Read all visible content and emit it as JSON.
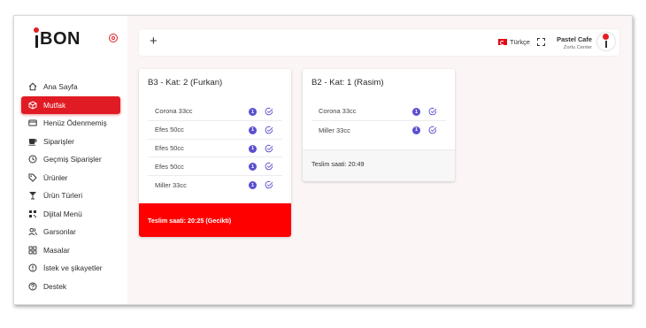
{
  "brand": {
    "logo_text": "BON",
    "logo_full": "İBON",
    "accent": "#e31e24"
  },
  "sidebar": {
    "items": [
      {
        "label": "Ana Sayfa",
        "icon": "home-icon"
      },
      {
        "label": "Mutfak",
        "icon": "kitchen-icon",
        "active": true
      },
      {
        "label": "Henüz Ödenmemiş",
        "icon": "card-icon"
      },
      {
        "label": "Siparişler",
        "icon": "cup-icon"
      },
      {
        "label": "Geçmiş Siparişler",
        "icon": "history-icon"
      },
      {
        "label": "Ürünler",
        "icon": "tag-icon"
      },
      {
        "label": "Ürün Türleri",
        "icon": "cocktail-icon"
      },
      {
        "label": "Dijital Menü",
        "icon": "qr-icon"
      },
      {
        "label": "Garsonlar",
        "icon": "users-icon"
      },
      {
        "label": "Masalar",
        "icon": "grid-icon"
      },
      {
        "label": "İstek ve şikayetler",
        "icon": "alert-icon"
      },
      {
        "label": "Destek",
        "icon": "help-icon"
      }
    ]
  },
  "header": {
    "add_label": "+",
    "language": "Türkçe",
    "cafe_name": "Pastel Cafe",
    "branch": "Zorlu Center"
  },
  "orders": [
    {
      "title": "B3 - Kat: 2 (Furkan)",
      "items": [
        {
          "name": "Corona 33cc",
          "qty": "1"
        },
        {
          "name": "Efes 50cc",
          "qty": "1"
        },
        {
          "name": "Efes 50cc",
          "qty": "1"
        },
        {
          "name": "Efes 50cc",
          "qty": "1"
        },
        {
          "name": "Miller 33cc",
          "qty": "1"
        }
      ],
      "footer": "Teslim saati: 20:25 (Gecikti)",
      "late": true
    },
    {
      "title": "B2 - Kat: 1 (Rasim)",
      "items": [
        {
          "name": "Corona 33cc",
          "qty": "1"
        },
        {
          "name": "Miller 33cc",
          "qty": "1"
        }
      ],
      "footer": "Teslim saati: 20:49",
      "late": false
    }
  ]
}
